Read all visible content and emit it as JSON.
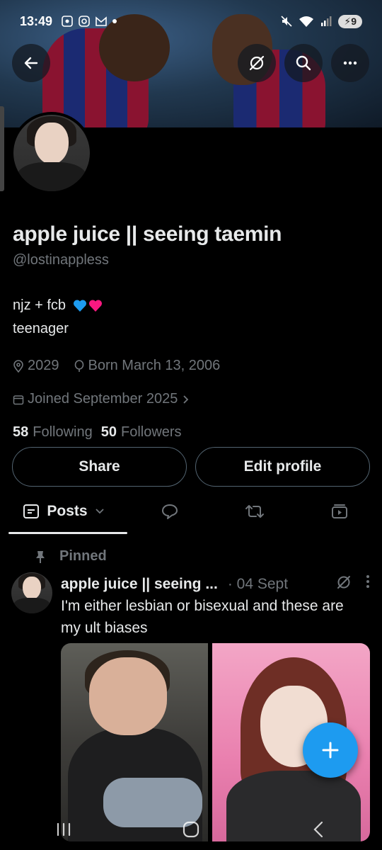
{
  "status_bar": {
    "time": "13:49",
    "battery": "9"
  },
  "profile": {
    "display_name": "apple juice || seeing taemin",
    "handle": "@lostinappless",
    "bio_line1": "njz + fcb",
    "bio_line2": "teenager",
    "location": "2029",
    "birthday": "Born March 13, 2006",
    "joined": "Joined September 2025",
    "following_count": "58",
    "following_label": "Following",
    "followers_count": "50",
    "followers_label": "Followers"
  },
  "actions": {
    "share_label": "Share",
    "edit_label": "Edit profile"
  },
  "tabs": {
    "posts_label": "Posts"
  },
  "post": {
    "pinned_label": "Pinned",
    "author": "apple juice || seeing ...",
    "time": "· 04 Sept",
    "text": "I'm either lesbian or bisexual and these are my ult biases"
  },
  "colors": {
    "accent": "#1d9bf0",
    "muted": "#71767b",
    "text": "#e7e9ea",
    "heart_blue": "#1d9bf0",
    "heart_red": "#f91880"
  },
  "icons": {
    "back": "arrow-left-icon",
    "grok": "grok-icon",
    "search": "search-icon",
    "more": "more-horizontal-icon",
    "location": "location-pin-icon",
    "birthday": "balloon-icon",
    "calendar": "calendar-icon",
    "replies": "speech-bubble-icon",
    "highlights": "retweet-icon",
    "media": "media-icon",
    "pin": "pin-icon",
    "compose": "plus-icon"
  }
}
